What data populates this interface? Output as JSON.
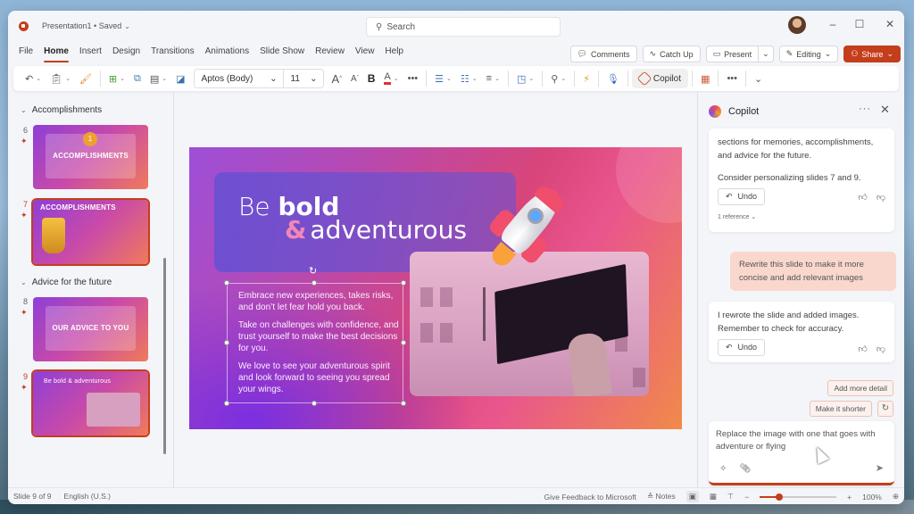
{
  "window": {
    "doc_title": "Presentation1 • Saved",
    "search_placeholder": "Search",
    "controls": {
      "minimize": "–",
      "maximize": "☐",
      "close": "✕"
    }
  },
  "menu": {
    "tabs": [
      "File",
      "Home",
      "Insert",
      "Design",
      "Transitions",
      "Animations",
      "Slide Show",
      "Review",
      "View",
      "Help"
    ],
    "active_tab": "Home",
    "actions": {
      "comments": "Comments",
      "catch_up": "Catch Up",
      "present": "Present",
      "editing": "Editing",
      "share": "Share"
    }
  },
  "ribbon": {
    "font_name": "Aptos (Body)",
    "font_size": "11",
    "bold": "B",
    "font_color_letter": "A",
    "grow_font": "A",
    "shrink_font": "A",
    "more": "•••",
    "copilot_label": "Copilot",
    "font_color": "#e03030",
    "icons": [
      "undo-icon",
      "paste-icon",
      "format-painter-icon",
      "new-slide-icon",
      "reuse-slides-icon",
      "layout-icon",
      "section-icon",
      "bullets-icon",
      "numbering-icon",
      "align-icon",
      "shapes-icon",
      "find-icon",
      "designer-icon",
      "dictate-icon",
      "copilot-icon",
      "add-ins-icon"
    ]
  },
  "slide_panel": {
    "sections": [
      {
        "title": "Accomplishments",
        "slides": [
          {
            "number": "6",
            "title": "ACCOMPLISHMENTS",
            "selected": false
          },
          {
            "number": "7",
            "title": "ACCOMPLISHMENTS",
            "selected": true
          }
        ]
      },
      {
        "title": "Advice for the future",
        "slides": [
          {
            "number": "8",
            "title": "OUR ADVICE TO YOU",
            "selected": false
          },
          {
            "number": "9",
            "title": "Be bold & adventurous",
            "selected": true
          }
        ]
      }
    ]
  },
  "slide": {
    "title_be": "Be",
    "title_bold": "bold",
    "title_amp": "&",
    "title_rest": "adventurous",
    "paragraphs": [
      "Embrace new experiences, takes risks, and don’t let fear hold you back.",
      "Take on challenges with confidence, and trust yourself to make the best decisions for you.",
      "We love to see your adventurous spirit and look forward to seeing you spread your wings."
    ]
  },
  "copilot": {
    "title": "Copilot",
    "messages": [
      {
        "role": "assistant",
        "text1": "sections for memories, accomplishments, and advice for the future.",
        "text2": "Consider personalizing slides 7 and 9.",
        "undo": "Undo",
        "reference": "1 reference"
      },
      {
        "role": "user",
        "text": "Rewrite this slide to make it more concise and add relevant images"
      },
      {
        "role": "assistant",
        "text1": "I rewrote the slide and added images. Remember to check for accuracy.",
        "undo": "Undo"
      }
    ],
    "suggestions": [
      "Add more detail",
      "Make it shorter"
    ],
    "compose_text": "Replace the image with one that goes with adventure or flying"
  },
  "statusbar": {
    "slide_info": "Slide 9 of 9",
    "language": "English (U.S.)",
    "feedback": "Give Feedback to Microsoft",
    "notes": "Notes",
    "zoom_level": "100%",
    "zoom_fraction": 0.25
  }
}
